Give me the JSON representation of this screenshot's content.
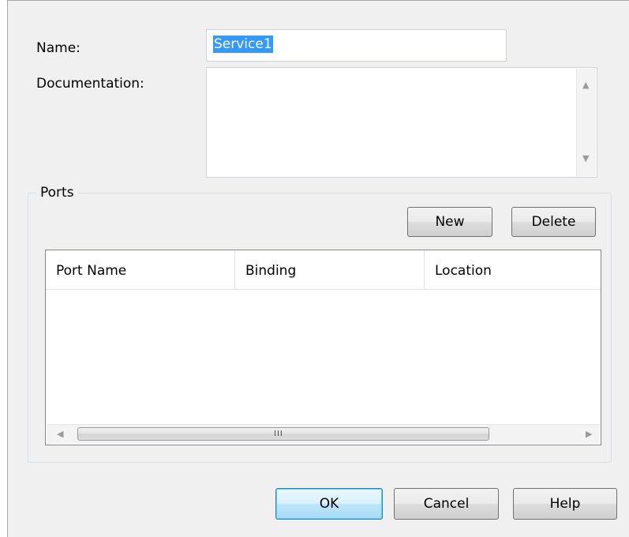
{
  "form": {
    "name_label": "Name:",
    "name_value": "Service1",
    "documentation_label": "Documentation:",
    "documentation_value": ""
  },
  "ports": {
    "title": "Ports",
    "new_label": "New",
    "delete_label": "Delete",
    "columns": [
      "Port Name",
      "Binding",
      "Location"
    ],
    "rows": [],
    "scroll_grip": "III"
  },
  "footer": {
    "ok_label": "OK",
    "cancel_label": "Cancel",
    "help_label": "Help"
  },
  "icons": {
    "scroll_up": "arrow-up-icon",
    "scroll_down": "arrow-down-icon",
    "scroll_left": "arrow-left-icon",
    "scroll_right": "arrow-right-icon"
  },
  "colors": {
    "selection": "#3399ff",
    "dialog_bg": "#f0f0f0",
    "default_button_border": "#3c7fb1"
  }
}
